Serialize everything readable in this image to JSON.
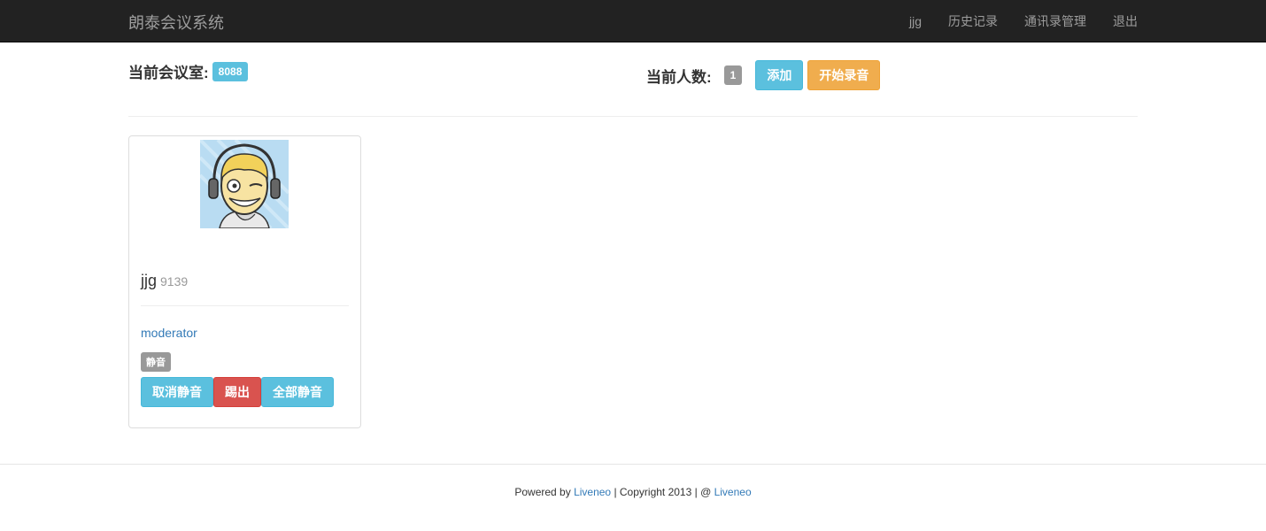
{
  "navbar": {
    "brand": "朗泰会议系统",
    "items": [
      {
        "label": "jjg"
      },
      {
        "label": "历史记录"
      },
      {
        "label": "通讯录管理"
      },
      {
        "label": "退出"
      }
    ]
  },
  "header": {
    "room_label": "当前会议室:",
    "room_number": "8088",
    "count_label": "当前人数:",
    "count_value": "1",
    "add_button": "添加",
    "record_button": "开始录音"
  },
  "participant": {
    "name": "jjg",
    "extension": "9139",
    "role": "moderator",
    "status_label": "静音",
    "unmute_button": "取消静音",
    "kick_button": "踢出",
    "mute_all_button": "全部静音"
  },
  "footer": {
    "powered_by": "Powered by ",
    "link1": "Liveneo",
    "copyright": " | Copyright 2013 | @ ",
    "link2": "Liveneo"
  }
}
